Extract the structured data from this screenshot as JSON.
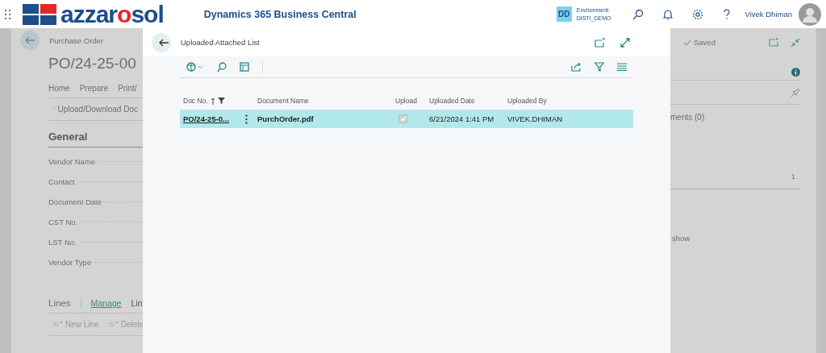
{
  "topbar": {
    "logo": [
      {
        "text": "azzar",
        "color": "#1d4e89"
      },
      {
        "text": "o",
        "color": "#e5262a"
      },
      {
        "text": "sol",
        "color": "#1d4e89"
      }
    ],
    "app_title": "Dynamics 365 Business Central",
    "env_badge": "DD",
    "env_label": "Environment:",
    "env_name": "DISTI_DEMO",
    "user": "Vivek Dhiman"
  },
  "background_page": {
    "caption": "Purchase Order",
    "title": "PO/24-25-00",
    "tabs": [
      "Home",
      "Prepare",
      "Print/"
    ],
    "action": "Upload/Download Doc",
    "section": "General",
    "fields": [
      "Vendor Name",
      "Contact",
      "Document Date",
      "CST No.",
      "LST No.",
      "Vendor Type"
    ],
    "lines_title": "Lines",
    "lines_tabs": [
      {
        "label": "Manage",
        "selected": true
      },
      {
        "label": "Lin",
        "selected": false
      }
    ],
    "lines_actions": [
      "New Line",
      "Delete"
    ],
    "saved": "Saved",
    "side_text": "ments (0)",
    "side_count": "1",
    "side_note": "show"
  },
  "dialog": {
    "title": "Uploaded Attached List",
    "columns": [
      {
        "label": "Doc No.",
        "sorted": true,
        "filtered": true
      },
      {
        "label": "Document Name",
        "sorted": false,
        "filtered": false
      },
      {
        "label": "Upload",
        "sorted": false,
        "filtered": false
      },
      {
        "label": "Uploaded Date",
        "sorted": false,
        "filtered": false
      },
      {
        "label": "Uploaded By",
        "sorted": false,
        "filtered": false
      }
    ],
    "rows": [
      {
        "doc_no": "PO/24-25-0...",
        "document_name": "PurchOrder.pdf",
        "upload": true,
        "uploaded_date": "6/21/2024 1:41 PM",
        "uploaded_by": "VIVEK.DHIMAN",
        "selected": true
      }
    ]
  }
}
